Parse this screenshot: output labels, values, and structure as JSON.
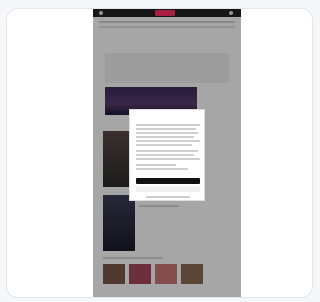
{
  "window": {
    "title": ""
  },
  "site": {
    "brand_color": "#ff2e63"
  },
  "dialog": {
    "title": "",
    "accept_label": "",
    "more_label": ""
  },
  "colors": {
    "card_bg": "#ffffff",
    "page_bg": "#f6f7fb",
    "topbar": "#222222",
    "overlay": "rgba(0,0,0,0.35)"
  }
}
